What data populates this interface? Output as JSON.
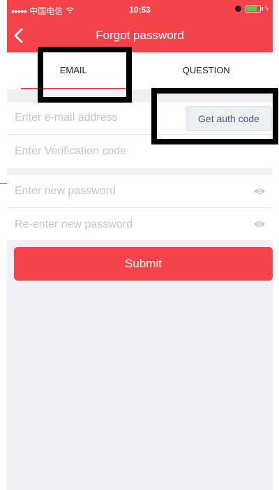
{
  "status_bar": {
    "carrier": "中国电信",
    "time": "10:53"
  },
  "nav": {
    "title": "Forgot password"
  },
  "tabs": [
    {
      "label": "EMAIL",
      "active": true
    },
    {
      "label": "QUESTION",
      "active": false
    }
  ],
  "form": {
    "email_placeholder": "Enter e-mail address",
    "auth_button_label": "Get auth code",
    "code_placeholder": "Enter Verification code",
    "new_password_placeholder": "Enter new password",
    "reenter_password_placeholder": "Re-enter new password",
    "submit_label": "Submit"
  },
  "icons": {
    "back": "chevron-left-icon",
    "eye": "eye-icon",
    "wifi": "wifi-icon",
    "alarm": "alarm-icon",
    "battery": "battery-icon"
  },
  "colors": {
    "accent": "#f4434b",
    "background": "#efeff4",
    "placeholder": "#c6c6cc"
  }
}
